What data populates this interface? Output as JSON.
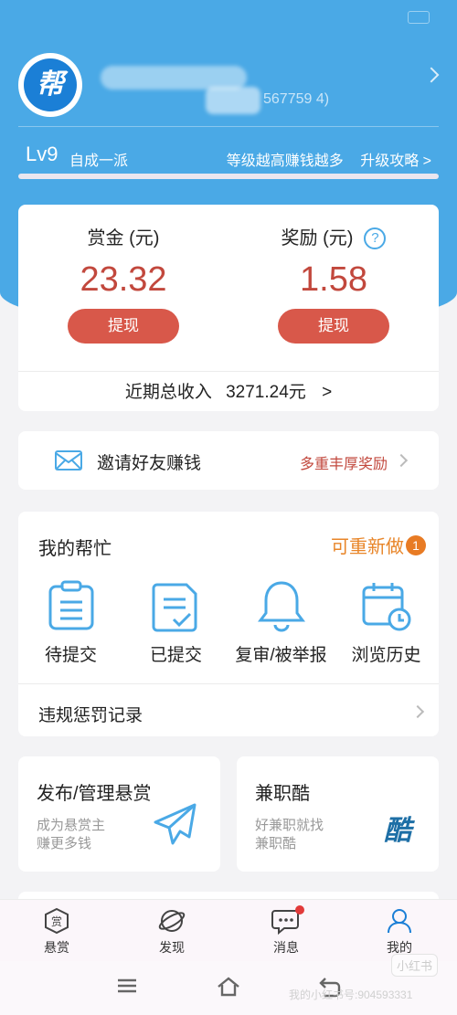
{
  "header": {
    "user_id_fragment": "567759 4)",
    "level": "Lv9",
    "level_name": "自成一派",
    "level_tip": "等级越高赚钱越多",
    "level_guide": "升级攻略 >",
    "avatar_text": "帮"
  },
  "wallet": {
    "bounty_label": "赏金 (元)",
    "bounty_value": "23.32",
    "reward_label": "奖励 (元)",
    "reward_value": "1.58",
    "withdraw_label": "提现",
    "help_mark": "?",
    "recent_income_label": "近期总收入",
    "recent_income_value": "3271.24元",
    "recent_income_arrow": ">"
  },
  "invite": {
    "label": "邀请好友赚钱",
    "promo": "多重丰厚奖励"
  },
  "my_help": {
    "title": "我的帮忙",
    "redo_label": "可重新做",
    "redo_count": "1",
    "items": [
      {
        "label": "待提交",
        "icon": "clipboard-icon"
      },
      {
        "label": "已提交",
        "icon": "check-doc-icon"
      },
      {
        "label": "复审/被举报",
        "icon": "bell-icon"
      },
      {
        "label": "浏览历史",
        "icon": "calendar-clock-icon"
      }
    ],
    "penalty_label": "违规惩罚记录"
  },
  "tiles": {
    "publish_title": "发布/管理悬赏",
    "publish_sub1": "成为悬赏主",
    "publish_sub2": "赚更多钱",
    "job_title": "兼职酷",
    "job_sub1": "好兼职就找",
    "job_sub2": "兼职酷",
    "job_logo": "酷"
  },
  "tabbar": {
    "tabs": [
      {
        "label": "悬赏",
        "icon": "bounty-icon"
      },
      {
        "label": "发现",
        "icon": "planet-icon"
      },
      {
        "label": "消息",
        "icon": "chat-icon"
      },
      {
        "label": "我的",
        "icon": "person-icon"
      }
    ],
    "active": "我的"
  },
  "watermark": {
    "brand": "小红书",
    "id_text": "我的小红书号:904593331"
  },
  "colors": {
    "primary_blue": "#4aa9e6",
    "amount_red": "#c2483d",
    "button_red": "#d8584a",
    "orange": "#e88528"
  }
}
